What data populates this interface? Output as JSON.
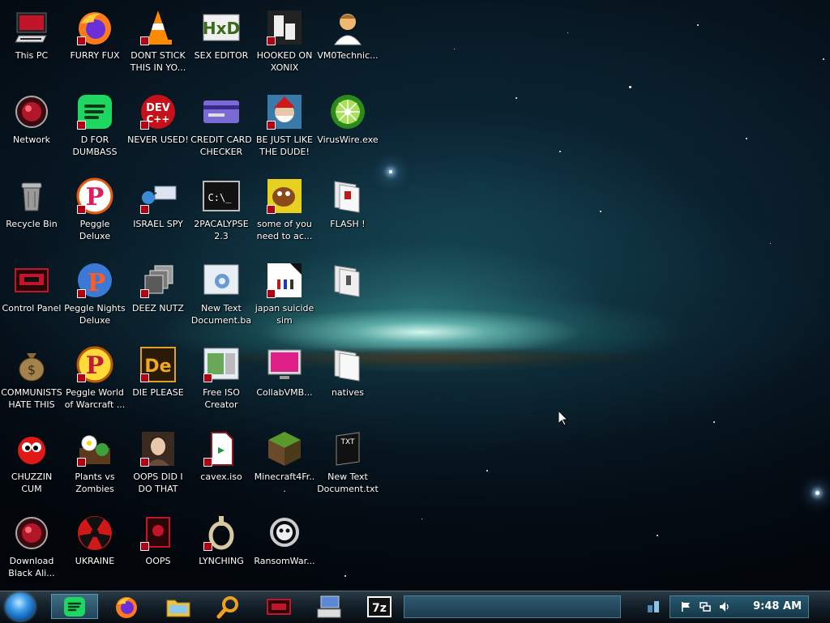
{
  "desktop": {
    "icons": [
      {
        "label": "This PC"
      },
      {
        "label": "FURRY FUX"
      },
      {
        "label": "DONT STICK THIS IN YO..."
      },
      {
        "label": "SEX EDITOR"
      },
      {
        "label": "HOOKED ON XONIX"
      },
      {
        "label": "VM0Technic..."
      },
      {
        "label": "Network"
      },
      {
        "label": "D FOR DUMBASS"
      },
      {
        "label": "NEVER USED!"
      },
      {
        "label": "CREDIT CARD CHECKER"
      },
      {
        "label": "BE JUST LIKE THE DUDE!"
      },
      {
        "label": "VirusWire.exe"
      },
      {
        "label": "Recycle Bin"
      },
      {
        "label": "Peggle Deluxe"
      },
      {
        "label": "ISRAEL SPY"
      },
      {
        "label": "2PACALYPSE 2.3"
      },
      {
        "label": "some of you need to ac..."
      },
      {
        "label": "FLASH !"
      },
      {
        "label": "Control Panel"
      },
      {
        "label": "Peggle Nights Deluxe"
      },
      {
        "label": "DEEZ NUTZ"
      },
      {
        "label": "New Text Document.bat"
      },
      {
        "label": "japan suicide sim"
      },
      {
        "label": ""
      },
      {
        "label": "COMMUNISTS HATE THIS G..."
      },
      {
        "label": "Peggle World of Warcraft ..."
      },
      {
        "label": "DIE PLEASE"
      },
      {
        "label": "Free ISO Creator"
      },
      {
        "label": "CollabVMB..."
      },
      {
        "label": "natives"
      },
      {
        "label": "CHUZZIN CUM"
      },
      {
        "label": "Plants vs Zombies"
      },
      {
        "label": "OOPS DID I DO THAT"
      },
      {
        "label": "cavex.iso"
      },
      {
        "label": "Minecraft4Fr..."
      },
      {
        "label": "New Text Document.txt"
      },
      {
        "label": "Download Black Ali..."
      },
      {
        "label": "UKRAINE"
      },
      {
        "label": "OOPS"
      },
      {
        "label": "LYNCHING"
      },
      {
        "label": "RansomWar..."
      }
    ],
    "icon_names": {
      "this_pc": "computer-icon",
      "furry_fux": "firefox-icon",
      "dont_stick": "vlc-cone-icon",
      "sex_editor": "hex-editor-icon",
      "hooked": "xonix-icon",
      "vm0": "doctor-icon",
      "network": "network-orb-icon",
      "d_for": "spotify-icon",
      "never_used": "dev-cpp-icon",
      "credit": "credit-card-icon",
      "dude": "santa-icon",
      "viruswire": "limewire-icon",
      "recycle": "recycle-bin-icon",
      "peggle": "peggle-icon",
      "israel": "spy-icon",
      "2pac": "terminal-icon",
      "some_of_you": "dog-icon",
      "flash": "folder-open-icon"
    }
  },
  "taskbar": {
    "clock": "9:48 AM",
    "start_icon": "start-orb-icon"
  },
  "colors": {
    "accent": "#2b6f8c",
    "taskbar_bg": "#14202a",
    "label_text": "#ffffff"
  }
}
